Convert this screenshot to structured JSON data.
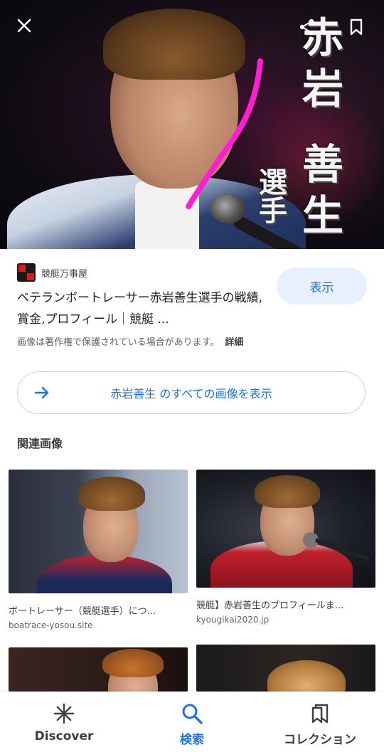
{
  "hero": {
    "overlay_name": "赤岩 善生",
    "overlay_title": "選手"
  },
  "icons": {
    "close": "close-icon",
    "share": "share-icon",
    "bookmark": "bookmark-icon"
  },
  "source": {
    "site_name": "競艇万事屋",
    "title": "ベテランボートレーサー赤岩善生選手の戦績,賞金,プロフィール｜競艇 ...",
    "view_label": "表示",
    "copyright_notice": "画像は著作権で保護されている場合があります。",
    "details_label": "詳細"
  },
  "all_images": {
    "label": "赤岩善生 のすべての画像を表示"
  },
  "related": {
    "heading": "関連画像",
    "items": [
      {
        "caption": "ボートレーサー（競艇選手）につ...",
        "domain": "boatrace-yosou.site"
      },
      {
        "caption": "競艇】赤岩善生のプロフィールま...",
        "domain": "kyougikai2020.jp"
      },
      {
        "caption": "",
        "domain": ""
      },
      {
        "caption": "",
        "domain": ""
      }
    ]
  },
  "bottom_nav": {
    "items": [
      {
        "label": "Discover",
        "icon": "asterisk-icon",
        "active": false
      },
      {
        "label": "検索",
        "icon": "search-icon",
        "active": true
      },
      {
        "label": "コレクション",
        "icon": "collections-icon",
        "active": false
      }
    ]
  },
  "colors": {
    "accent": "#1a73e8",
    "accent_bg": "#e8f0fe",
    "annotation_pink": "#ff1fd0"
  }
}
